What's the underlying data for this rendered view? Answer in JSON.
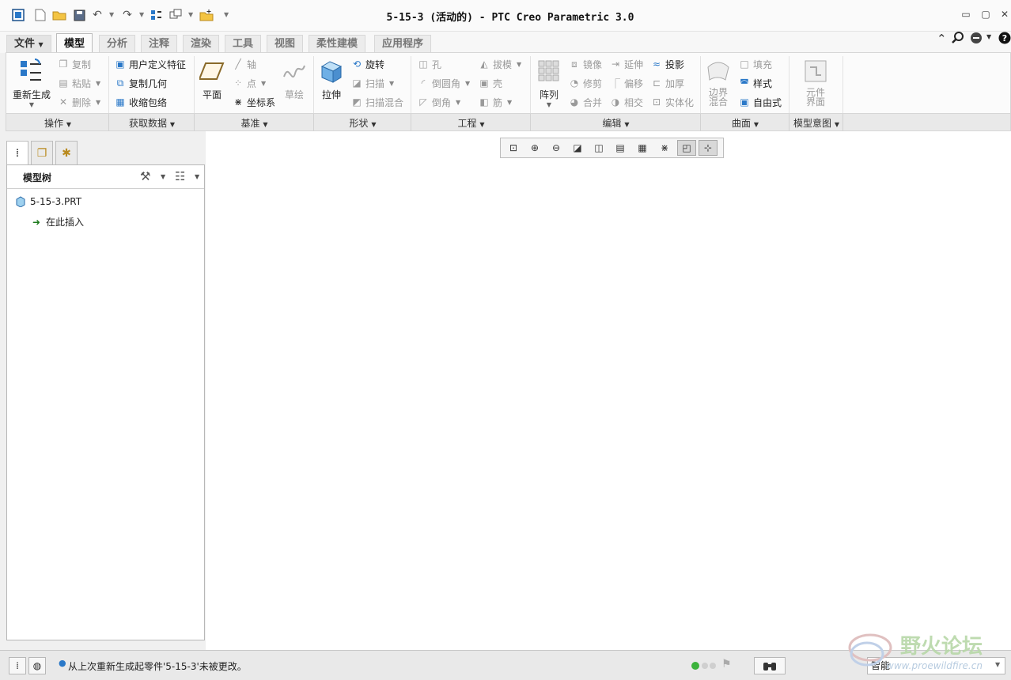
{
  "window": {
    "title": "5-15-3 (活动的) - PTC Creo Parametric 3.0",
    "minimize": "▭",
    "restore": "▢",
    "close": "✕"
  },
  "tabs": [
    "文件",
    "模型",
    "分析",
    "注释",
    "渲染",
    "工具",
    "视图",
    "柔性建模",
    "应用程序"
  ],
  "ribbon": {
    "operations": {
      "regenerate": "重新生成",
      "copy": "复制",
      "paste": "粘贴",
      "delete": "删除",
      "group": "操作"
    },
    "get_data": {
      "udf": "用户定义特征",
      "copy_geom": "复制几何",
      "shrinkwrap": "收缩包络",
      "group": "获取数据"
    },
    "datum": {
      "plane": "平面",
      "axis": "轴",
      "point": "点",
      "csys": "坐标系",
      "sketch": "草绘",
      "group": "基准"
    },
    "shapes": {
      "extrude": "拉伸",
      "revolve": "旋转",
      "sweep": "扫描",
      "swept_blend": "扫描混合",
      "group": "形状"
    },
    "engineering": {
      "hole": "孔",
      "round": "倒圆角",
      "chamfer": "倒角",
      "draft": "拔模",
      "shell": "壳",
      "rib": "筋",
      "group": "工程"
    },
    "editing": {
      "pattern": "阵列",
      "mirror": "镜像",
      "trim": "修剪",
      "merge": "合并",
      "extend": "延伸",
      "offset": "偏移",
      "intersect": "相交",
      "project": "投影",
      "thicken": "加厚",
      "solidify": "实体化",
      "group": "编辑"
    },
    "surfaces": {
      "boundary_blend_1": "边界",
      "boundary_blend_2": "混合",
      "fill": "填充",
      "style": "样式",
      "freestyle": "自由式",
      "group": "曲面"
    },
    "model_intent": {
      "component_interface_1": "元件",
      "component_interface_2": "界面",
      "group": "模型意图"
    }
  },
  "panel": {
    "title": "模型树",
    "items": [
      {
        "label": "5-15-3.PRT",
        "icon": "part-icon"
      },
      {
        "label": "在此插入",
        "icon": "insert-here-arrow-icon"
      }
    ]
  },
  "status": {
    "message": "从上次重新生成起零件'5-15-3'未被更改。",
    "filter": "智能"
  },
  "watermark": {
    "text": "野火论坛",
    "url": "www.proewildfire.cn"
  },
  "colors": {
    "accent_blue": "#2a78c8",
    "status_green": "#3cb33c",
    "watermark": "#b8d8a8"
  }
}
